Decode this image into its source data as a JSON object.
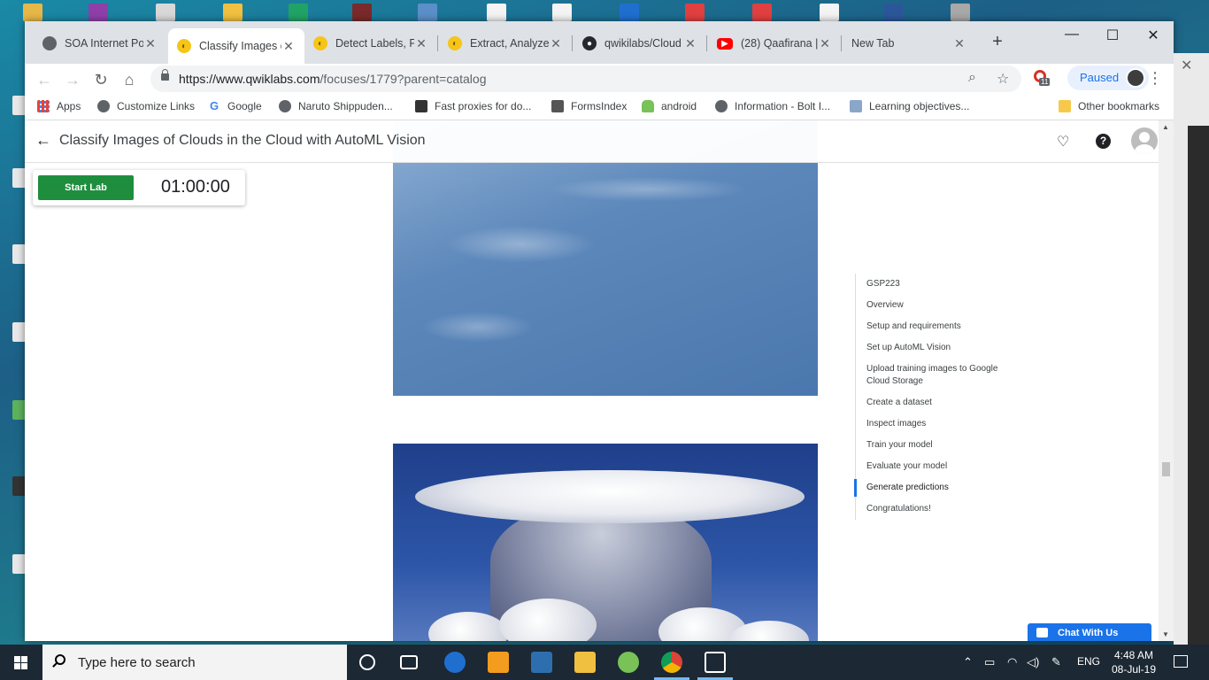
{
  "browser": {
    "tabs": [
      {
        "title": "SOA Internet Por",
        "favicon": "globe-icon",
        "active": false
      },
      {
        "title": "Classify Images c",
        "favicon": "qwiklabs-icon",
        "active": true
      },
      {
        "title": "Detect Labels, Fa",
        "favicon": "qwiklabs-icon",
        "active": false
      },
      {
        "title": "Extract, Analyze,",
        "favicon": "qwiklabs-icon",
        "active": false
      },
      {
        "title": "qwikilabs/Cloud",
        "favicon": "github-icon",
        "active": false
      },
      {
        "title": "(28) Qaafirana | ",
        "favicon": "youtube-icon",
        "active": false
      },
      {
        "title": "New Tab",
        "favicon": "",
        "active": false
      }
    ],
    "url_host": "https://www.qwiklabs.com",
    "url_path": "/focuses/1779?parent=catalog",
    "profile_status": "Paused",
    "extension_badge": "11",
    "bookmarks": [
      {
        "label": "Apps",
        "icon": "apps-grid-icon"
      },
      {
        "label": "Customize Links",
        "icon": "globe-icon"
      },
      {
        "label": "Google",
        "icon": "google-icon"
      },
      {
        "label": "Naruto Shippuden...",
        "icon": "globe-icon"
      },
      {
        "label": "Fast proxies for do...",
        "icon": "proxy-icon"
      },
      {
        "label": "FormsIndex",
        "icon": "forms-icon"
      },
      {
        "label": "android",
        "icon": "android-icon"
      },
      {
        "label": "Information - Bolt I...",
        "icon": "globe-icon"
      },
      {
        "label": "Learning objectives...",
        "icon": "learning-icon"
      }
    ],
    "other_bookmarks": "Other bookmarks"
  },
  "page": {
    "title": "Classify Images of Clouds in the Cloud with AutoML Vision",
    "start_lab_label": "Start Lab",
    "timer": "01:00:00",
    "toc": [
      {
        "label": "GSP223",
        "active": false
      },
      {
        "label": "Overview",
        "active": false
      },
      {
        "label": "Setup and requirements",
        "active": false
      },
      {
        "label": "Set up AutoML Vision",
        "active": false
      },
      {
        "label": "Upload training images to Google Cloud Storage",
        "active": false
      },
      {
        "label": "Create a dataset",
        "active": false
      },
      {
        "label": "Inspect images",
        "active": false
      },
      {
        "label": "Train your model",
        "active": false
      },
      {
        "label": "Evaluate your model",
        "active": false
      },
      {
        "label": "Generate predictions",
        "active": true
      },
      {
        "label": "Congratulations!",
        "active": false
      }
    ],
    "chat_label": "Chat With Us"
  },
  "taskbar": {
    "search_placeholder": "Type here to search",
    "language": "ENG",
    "time": "4:48 AM",
    "date": "08-Jul-19"
  },
  "colors": {
    "start_lab_green": "#1e8e3e",
    "accent_blue": "#1a73e8",
    "taskbar": "#1c2833"
  }
}
